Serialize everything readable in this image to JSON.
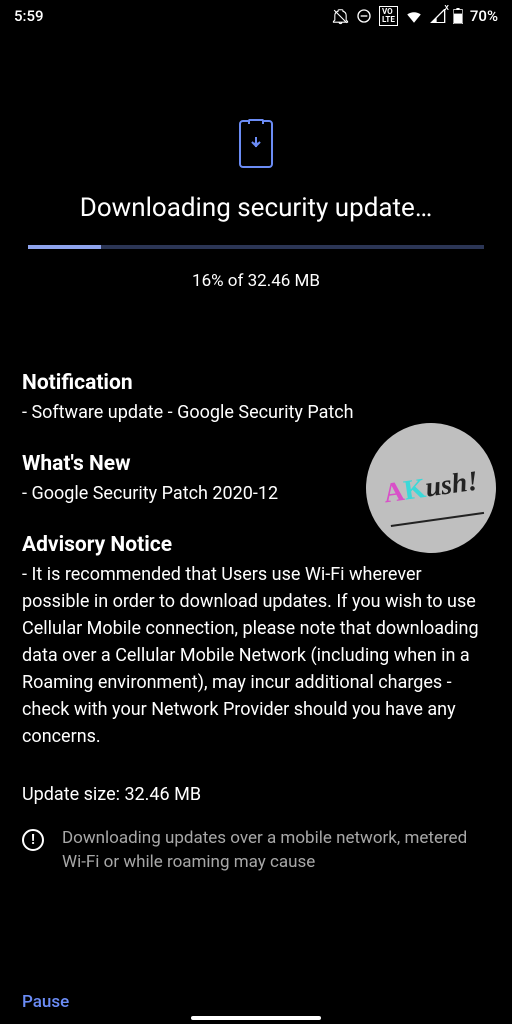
{
  "status": {
    "time": "5:59",
    "battery": "70%",
    "volte": "VO\nLTE"
  },
  "header": {
    "title": "Downloading security update…"
  },
  "progress": {
    "percent": 16,
    "text": "16% of 32.46 MB"
  },
  "sections": {
    "notification": {
      "heading": "Notification",
      "body": "- Software update - Google Security Patch"
    },
    "whatsnew": {
      "heading": "What's New",
      "body": "- Google Security Patch 2020-12"
    },
    "advisory": {
      "heading": "Advisory Notice",
      "body": "- It is recommended that Users use Wi-Fi wherever possible in order to download updates. If you wish to use Cellular Mobile connection, please note that downloading data over a Cellular Mobile Network (including when in a Roaming environment), may incur additional charges - check with your Network Provider should you have any concerns."
    },
    "size": "Update size: 32.46 MB"
  },
  "warning": {
    "text": "Downloading updates over a mobile network, metered Wi-Fi or while roaming may cause"
  },
  "footer": {
    "pause": "Pause"
  },
  "watermark": {
    "a": "A",
    "k": "K",
    "ush": "ush!"
  }
}
